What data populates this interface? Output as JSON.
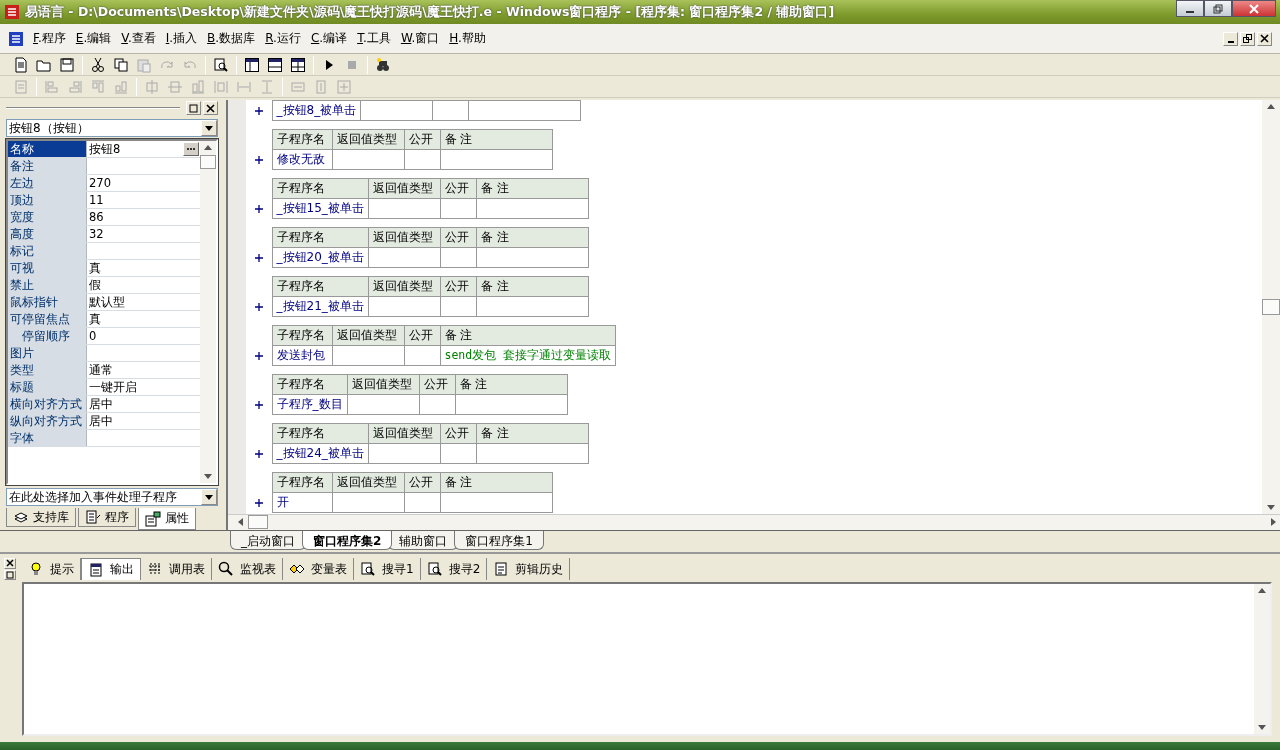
{
  "window": {
    "title": "易语言 - D:\\Documents\\Desktop\\新建文件夹\\源码\\魔王快打源码\\魔王快打.e - Windows窗口程序 - [程序集: 窗口程序集2 / 辅助窗口]"
  },
  "menu": [
    "F.程序",
    "E.编辑",
    "V.查看",
    "I.插入",
    "B.数据库",
    "R.运行",
    "C.编译",
    "T.工具",
    "W.窗口",
    "H.帮助"
  ],
  "left_panel": {
    "object": "按钮8（按钮）",
    "properties": [
      {
        "name": "名称",
        "value": "按钮8",
        "selected": true
      },
      {
        "name": "备注",
        "selected": false
      },
      {
        "name": "左边",
        "value": "270",
        "selected": false
      },
      {
        "name": "顶边",
        "value": "11",
        "selected": false
      },
      {
        "name": "宽度",
        "value": "86",
        "selected": false
      },
      {
        "name": "高度",
        "value": "32",
        "selected": false
      },
      {
        "name": "标记",
        "selected": false
      },
      {
        "name": "可视",
        "value": "真",
        "selected": false
      },
      {
        "name": "禁止",
        "value": "假",
        "selected": false
      },
      {
        "name": "鼠标指针",
        "value": "默认型",
        "selected": false
      },
      {
        "name": "可停留焦点",
        "value": "真",
        "selected": false,
        "children": [
          {
            "name": "停留顺序",
            "value": "0",
            "selected": false
          }
        ]
      },
      {
        "name": "图片",
        "selected": false
      },
      {
        "name": "类型",
        "value": "通常",
        "selected": false
      },
      {
        "name": "标题",
        "value": "一键开启",
        "selected": false
      },
      {
        "name": "横向对齐方式",
        "value": "居中",
        "selected": false
      },
      {
        "name": "纵向对齐方式",
        "value": "居中",
        "selected": false
      },
      {
        "name": "字体",
        "selected": false
      }
    ],
    "event_combo": "在此处选择加入事件处理子程序",
    "tabs": [
      {
        "label": "支持库",
        "selected": false
      },
      {
        "label": "程序",
        "selected": false
      },
      {
        "label": "属性",
        "selected": true
      }
    ]
  },
  "subroutines": [
    {
      "name": "_按钮8_被单击"
    },
    {
      "columns": [
        "子程序名",
        "返回值类型",
        "公开",
        "备 注"
      ],
      "name": "修改无敌"
    },
    {
      "columns": [
        "子程序名",
        "返回值类型",
        "公开",
        "备 注"
      ],
      "name": "_按钮15_被单击"
    },
    {
      "columns": [
        "子程序名",
        "返回值类型",
        "公开",
        "备 注"
      ],
      "name": "_按钮20_被单击"
    },
    {
      "columns": [
        "子程序名",
        "返回值类型",
        "公开",
        "备 注"
      ],
      "name": "_按钮21_被单击"
    },
    {
      "columns": [
        "子程序名",
        "返回值类型",
        "公开",
        "备 注"
      ],
      "name": "发送封包",
      "comment": "send发包 套接字通过变量读取"
    },
    {
      "columns": [
        "子程序名",
        "返回值类型",
        "公开",
        "备 注"
      ],
      "name": "子程序_数目"
    },
    {
      "columns": [
        "子程序名",
        "返回值类型",
        "公开",
        "备 注"
      ],
      "name": "_按钮24_被单击"
    },
    {
      "columns": [
        "子程序名",
        "返回值类型",
        "公开",
        "备 注"
      ],
      "name": "开"
    }
  ],
  "code_tabs": [
    {
      "label": "_启动窗口",
      "selected": false
    },
    {
      "label": "窗口程序集2",
      "selected": true
    },
    {
      "label": "辅助窗口",
      "selected": false
    },
    {
      "label": "窗口程序集1",
      "selected": false
    }
  ],
  "output_tabs": [
    {
      "label": "提示",
      "selected": false
    },
    {
      "label": "输出",
      "selected": true
    },
    {
      "label": "调用表",
      "selected": false
    },
    {
      "label": "监视表",
      "selected": false
    },
    {
      "label": "变量表",
      "selected": false
    },
    {
      "label": "搜寻1",
      "selected": false
    },
    {
      "label": "搜寻2",
      "selected": false
    },
    {
      "label": "剪辑历史",
      "selected": false
    }
  ]
}
